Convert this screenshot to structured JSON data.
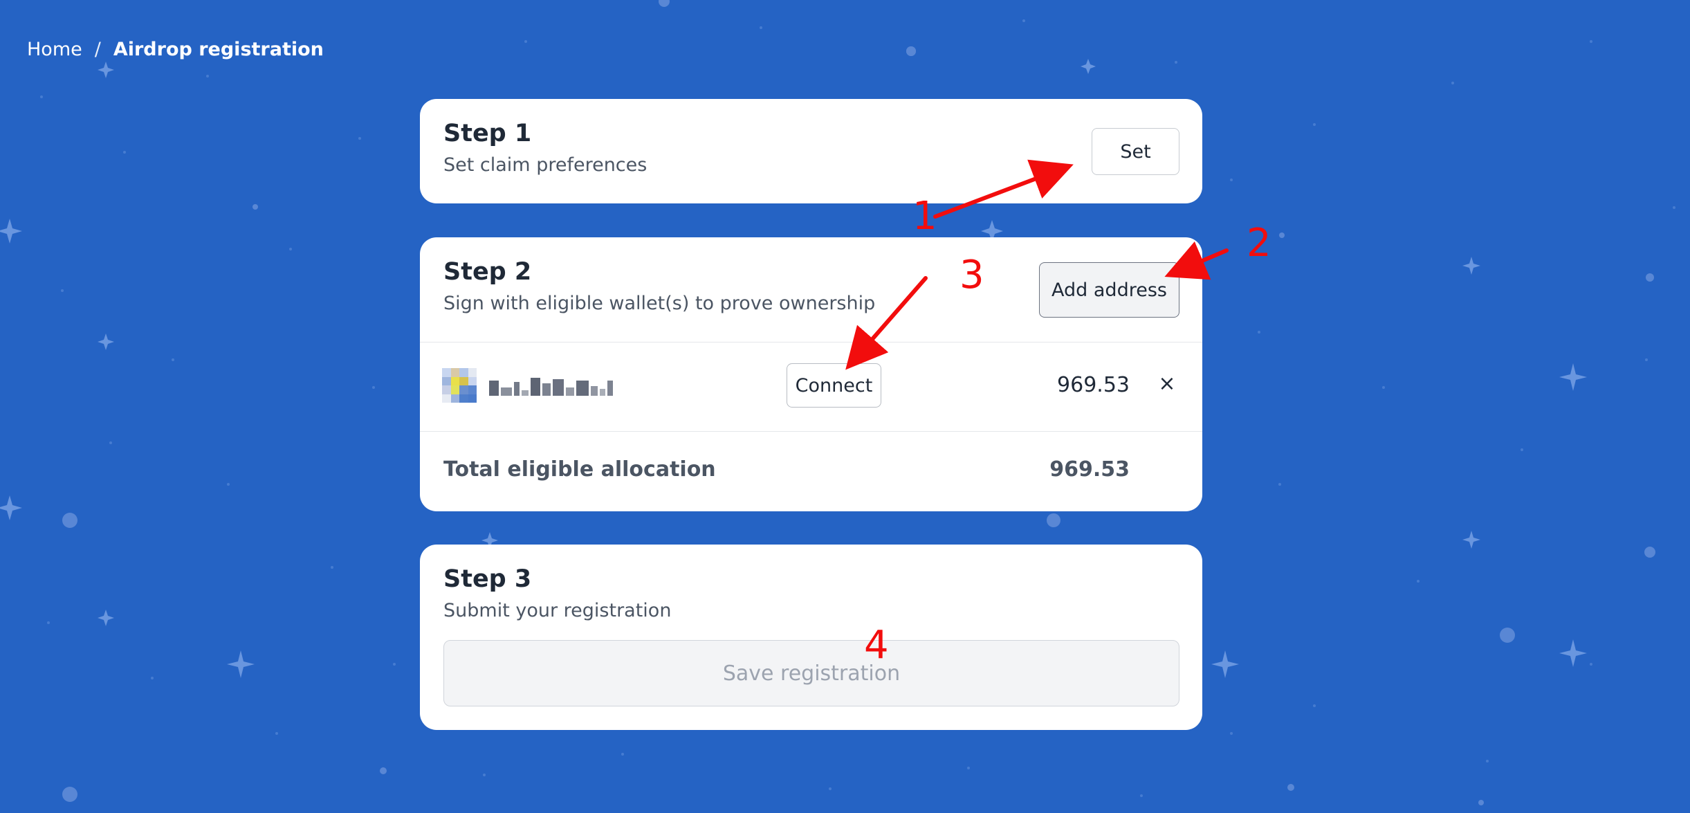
{
  "breadcrumb": {
    "home": "Home",
    "separator": "/",
    "current": "Airdrop registration"
  },
  "step1": {
    "title": "Step 1",
    "subtitle": "Set claim preferences",
    "button_label": "Set"
  },
  "step2": {
    "title": "Step 2",
    "subtitle": "Sign with eligible wallet(s) to prove ownership",
    "add_button_label": "Add address",
    "wallet": {
      "address": "(pixelated address)",
      "connect_label": "Connect",
      "amount": "969.53",
      "remove_label": "×"
    },
    "total_label": "Total eligible allocation",
    "total_value": "969.53"
  },
  "step3": {
    "title": "Step 3",
    "subtitle": "Submit your registration",
    "save_label": "Save registration"
  },
  "annotations": {
    "n1": "1",
    "n2": "2",
    "n3": "3",
    "n4": "4"
  },
  "colors": {
    "background": "#2563c4",
    "card": "#ffffff",
    "annotation_red": "#f20d0d",
    "disabled_text": "#9ca3af"
  }
}
